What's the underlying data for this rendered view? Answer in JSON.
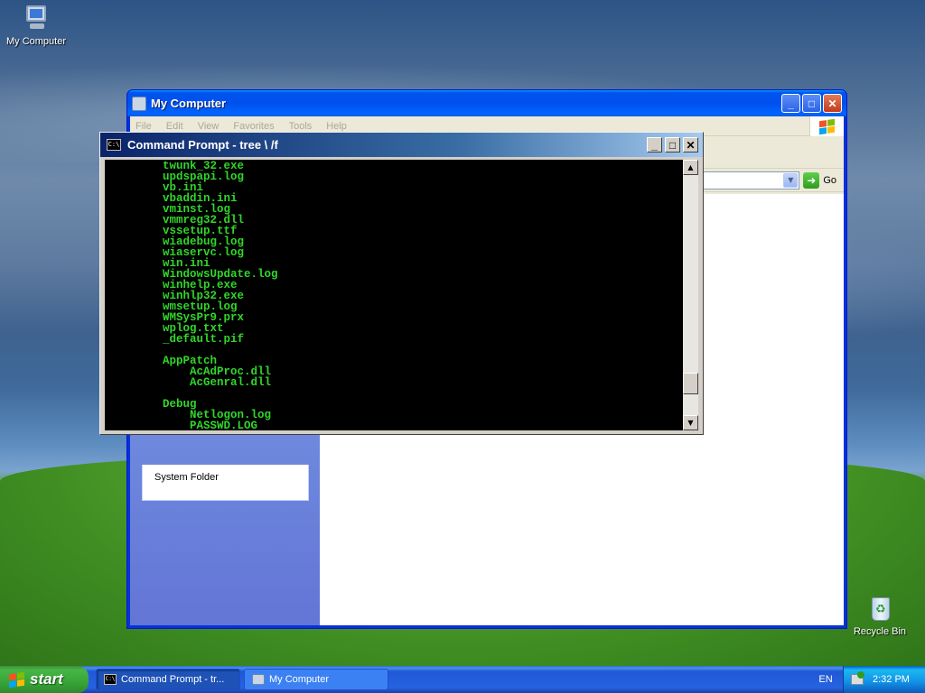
{
  "desktop": {
    "icons": [
      {
        "label": "My Computer"
      },
      {
        "label": "Recycle Bin"
      }
    ]
  },
  "my_computer": {
    "title": "My Computer",
    "menu": [
      "File",
      "Edit",
      "View",
      "Favorites",
      "Tools",
      "Help"
    ],
    "go_label": "Go",
    "task_item": "System Folder"
  },
  "cmd": {
    "title": "Command Prompt - tree \\ /f",
    "icon_text": "C:\\",
    "lines": [
      "        twunk_32.exe",
      "        updspapi.log",
      "        vb.ini",
      "        vbaddin.ini",
      "        vminst.log",
      "        vmmreg32.dll",
      "        vssetup.ttf",
      "        wiadebug.log",
      "        wiaservc.log",
      "        win.ini",
      "        WindowsUpdate.log",
      "        winhelp.exe",
      "        winhlp32.exe",
      "        wmsetup.log",
      "        WMSysPr9.prx",
      "        wplog.txt",
      "        _default.pif",
      "",
      "        AppPatch",
      "            AcAdProc.dll",
      "            AcGenral.dll",
      "",
      "        Debug",
      "            Netlogon.log",
      "            PASSWD.LOG"
    ]
  },
  "taskbar": {
    "start_label": "start",
    "buttons": [
      {
        "label": "Command Prompt - tr..."
      },
      {
        "label": "My Computer"
      }
    ],
    "language": "EN",
    "clock": "2:32 PM"
  },
  "colors": {
    "console_text": "#31d62a",
    "console_bg": "#000000",
    "xp_title_blue": "#0053ee",
    "start_green": "#37a537"
  }
}
